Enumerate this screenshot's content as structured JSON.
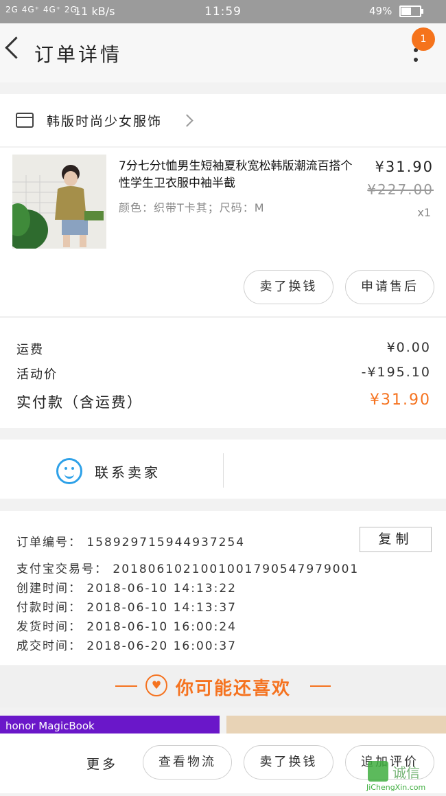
{
  "status_bar": {
    "signal": "2G 4G⁺ 4G⁺ 2G.",
    "speed": "11 kB/s",
    "time": "11:59",
    "battery": "49%"
  },
  "header": {
    "title": "订单详情",
    "badge_count": "1"
  },
  "shop": {
    "name": "韩版时尚少女服饰"
  },
  "product": {
    "title": "7分七分t恤男生短袖夏秋宽松韩版潮流百搭个性学生卫衣服中袖半截",
    "spec": "颜色：织带T卡其；尺码：M",
    "price": "¥31.90",
    "original_price": "¥227.00",
    "quantity": "x1",
    "exchange_button": "卖了换钱",
    "after_sale_button": "申请售后"
  },
  "fees": {
    "shipping_label": "运费",
    "shipping_value": "¥0.00",
    "promo_label": "活动价",
    "promo_value": "-¥195.10",
    "paid_label": "实付款（含运费）",
    "paid_value": "¥31.90",
    "accent_color": "#f57320"
  },
  "contact": {
    "label": "联系卖家"
  },
  "order_info": {
    "order_no": "订单编号：  158929715944937254",
    "copy_button": "复制",
    "alipay_no": "支付宝交易号：  2018061021001001790547979001",
    "created": "创建时间：  2018-06-10 14:13:22",
    "paid": "付款时间：  2018-06-10 14:13:37",
    "shipped": "发货时间：  2018-06-10 16:00:24",
    "completed": "成交时间：  2018-06-20 16:00:37"
  },
  "recommend": {
    "title": "你可能还喜欢",
    "ad_text": "honor  MagicBook"
  },
  "bottom_bar": {
    "more": "更多",
    "logistics": "查看物流",
    "sell": "卖了换钱",
    "review": "追加评价"
  },
  "watermark": {
    "text": "JiChengXin.com"
  }
}
